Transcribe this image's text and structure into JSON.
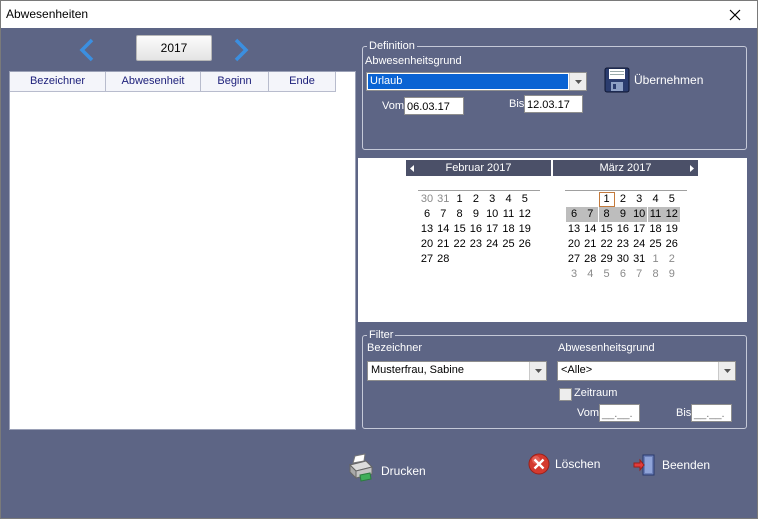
{
  "window": {
    "title": "Abwesenheiten"
  },
  "toolbar": {
    "year": "2017"
  },
  "list": {
    "columns": [
      "Bezeichner",
      "Abwesenheit",
      "Beginn",
      "Ende"
    ]
  },
  "definition": {
    "legend": "Definition",
    "reason_label": "Abwesenheitsgrund",
    "reason_value": "Urlaub",
    "apply_label": "Übernehmen",
    "from_label": "Vom",
    "from_value": "06.03.17",
    "to_label": "Bis",
    "to_value": "12.03.17"
  },
  "calendar": {
    "months": [
      {
        "title": "Februar 2017",
        "weeks": [
          [
            "30",
            "31",
            "1",
            "2",
            "3",
            "4",
            "5"
          ],
          [
            "6",
            "7",
            "8",
            "9",
            "10",
            "11",
            "12"
          ],
          [
            "13",
            "14",
            "15",
            "16",
            "17",
            "18",
            "19"
          ],
          [
            "20",
            "21",
            "22",
            "23",
            "24",
            "25",
            "26"
          ],
          [
            "27",
            "28",
            "",
            "",
            "",
            "",
            ""
          ]
        ],
        "other_month": [
          [
            0,
            0
          ],
          [
            0,
            1
          ]
        ],
        "range_row": -1
      },
      {
        "title": "März 2017",
        "weeks": [
          [
            "",
            "",
            "1",
            "2",
            "3",
            "4",
            "5"
          ],
          [
            "6",
            "7",
            "8",
            "9",
            "10",
            "11",
            "12"
          ],
          [
            "13",
            "14",
            "15",
            "16",
            "17",
            "18",
            "19"
          ],
          [
            "20",
            "21",
            "22",
            "23",
            "24",
            "25",
            "26"
          ],
          [
            "27",
            "28",
            "29",
            "30",
            "31",
            "1",
            "2"
          ],
          [
            "3",
            "4",
            "5",
            "6",
            "7",
            "8",
            "9"
          ]
        ],
        "other_month": [
          [
            4,
            5
          ],
          [
            4,
            6
          ],
          [
            5,
            0
          ],
          [
            5,
            1
          ],
          [
            5,
            2
          ],
          [
            5,
            3
          ],
          [
            5,
            4
          ],
          [
            5,
            5
          ],
          [
            5,
            6
          ]
        ],
        "range_row": 1,
        "today": [
          0,
          2
        ]
      }
    ]
  },
  "filter": {
    "legend": "Filter",
    "name_label": "Bezeichner",
    "name_value": "Musterfrau, Sabine",
    "reason_label": "Abwesenheitsgrund",
    "reason_value": "<Alle>",
    "period_label": "Zeitraum",
    "from_label": "Vom",
    "from_value": "__.__.",
    "to_label": "Bis",
    "to_value": "__.__."
  },
  "actions": {
    "print": "Drucken",
    "delete": "Löschen",
    "exit": "Beenden"
  },
  "colors": {
    "background": "#5d6585",
    "selection": "#0a63d3",
    "nav_arrow": "#3b8fe0",
    "calendar_header": "#4b5068"
  }
}
